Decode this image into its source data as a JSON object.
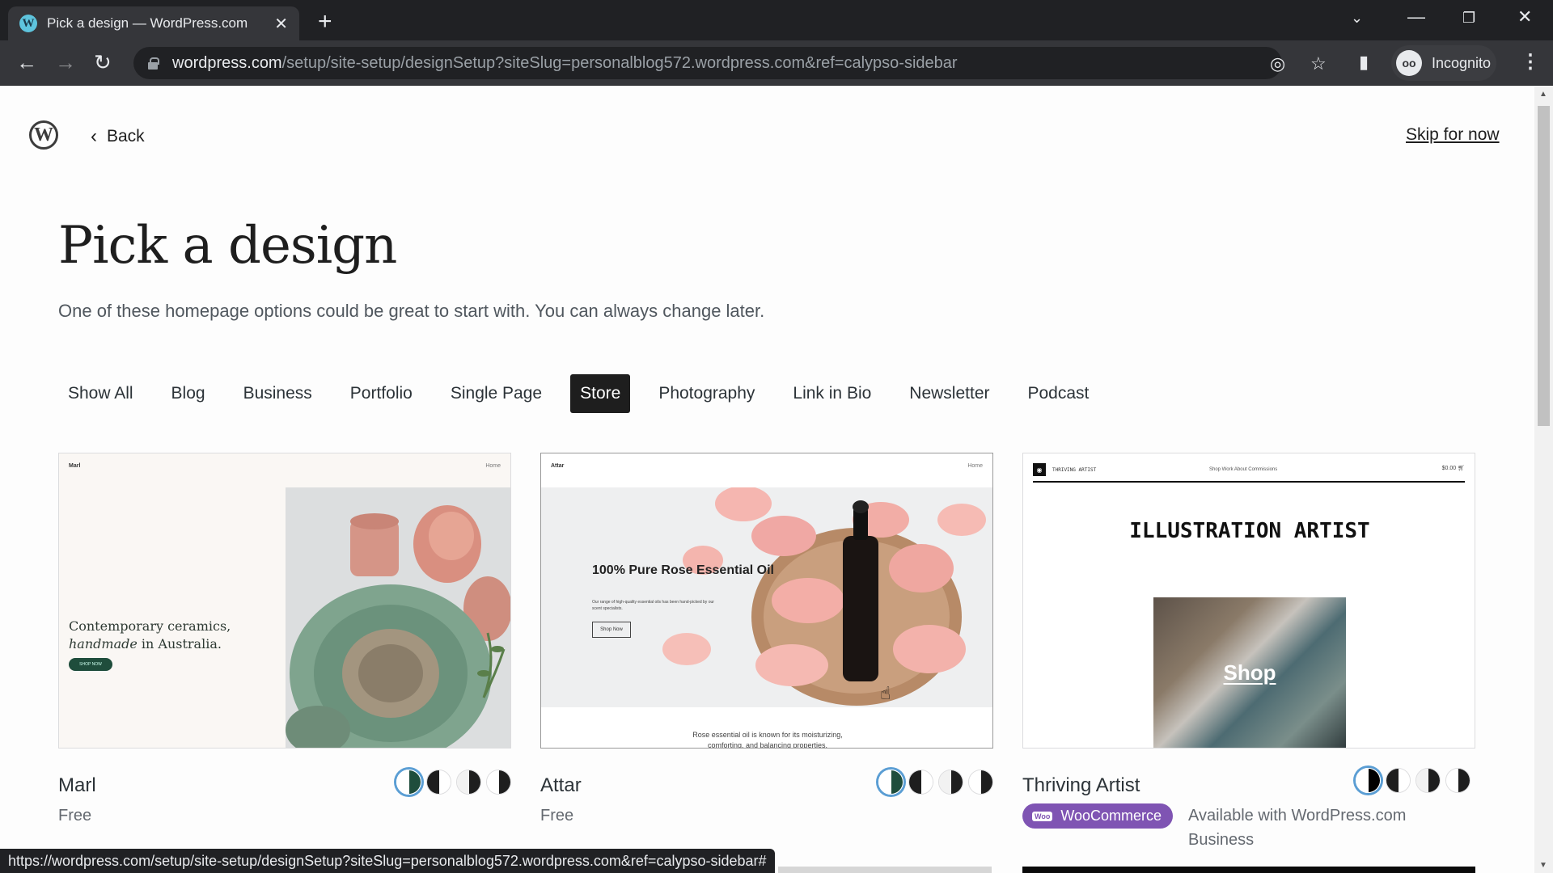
{
  "browser": {
    "tab_title": "Pick a design — WordPress.com",
    "favicon": "wordpress-icon",
    "url_host": "wordpress.com",
    "url_path": "/setup/site-setup/designSetup?siteSlug=personalblog572.wordpress.com&ref=calypso-sidebar",
    "profile_label": "Incognito",
    "status_url": "https://wordpress.com/setup/site-setup/designSetup?siteSlug=personalblog572.wordpress.com&ref=calypso-sidebar#"
  },
  "header": {
    "back_label": "Back",
    "skip_label": "Skip for now"
  },
  "main": {
    "title": "Pick a design",
    "subtitle": "One of these homepage options could be great to start with. You can always change later.",
    "filters": [
      {
        "label": "Show All",
        "active": false
      },
      {
        "label": "Blog",
        "active": false
      },
      {
        "label": "Business",
        "active": false
      },
      {
        "label": "Portfolio",
        "active": false
      },
      {
        "label": "Single Page",
        "active": false
      },
      {
        "label": "Store",
        "active": true
      },
      {
        "label": "Photography",
        "active": false
      },
      {
        "label": "Link in Bio",
        "active": false
      },
      {
        "label": "Newsletter",
        "active": false
      },
      {
        "label": "Podcast",
        "active": false
      }
    ],
    "designs": [
      {
        "name": "Marl",
        "price": "Free",
        "preview": {
          "brand": "Marl",
          "nav": "Home",
          "headline_1": "Contemporary ceramics,",
          "headline_2_italic": "handmade",
          "headline_2_rest": " in Australia.",
          "button": "SHOP NOW"
        },
        "swatches": [
          {
            "left": "#ffffff",
            "right": "#1f4d3c",
            "selected": true
          },
          {
            "left": "#1e1e1e",
            "right": "#ffffff",
            "selected": false
          },
          {
            "left": "#f2f2f2",
            "right": "#1e1e1e",
            "selected": false
          },
          {
            "left": "#ffffff",
            "right": "#1e1e1e",
            "selected": false
          }
        ]
      },
      {
        "name": "Attar",
        "price": "Free",
        "preview": {
          "brand": "Attar",
          "nav": "Home",
          "headline": "100% Pure Rose Essential Oil",
          "description": "Our range of high-quality essential oils has been hand-picked by our scent specialists.",
          "button": "Shop Now",
          "footer_1": "Rose essential oil is known for its moisturizing,",
          "footer_2": "comforting, and balancing properties."
        },
        "swatches": [
          {
            "left": "#ffffff",
            "right": "#1f4d3c",
            "selected": true
          },
          {
            "left": "#1e1e1e",
            "right": "#ffffff",
            "selected": false
          },
          {
            "left": "#f2f2f2",
            "right": "#1e1e1e",
            "selected": false
          },
          {
            "left": "#ffffff",
            "right": "#1e1e1e",
            "selected": false
          }
        ]
      },
      {
        "name": "Thriving Artist",
        "badge": "WooCommerce",
        "availability": "Available with WordPress.com Business",
        "preview": {
          "brand": "THRIVING ARTIST",
          "nav": "Shop  Work  About  Commissions",
          "cart": "$0.00",
          "headline": "ILLUSTRATION ARTIST",
          "shop_label": "Shop"
        },
        "swatches": [
          {
            "left": "#ffffff",
            "right": "#000000",
            "selected": true
          },
          {
            "left": "#1e1e1e",
            "right": "#ffffff",
            "selected": false
          },
          {
            "left": "#f2f2f2",
            "right": "#1e1e1e",
            "selected": false
          },
          {
            "left": "#ffffff",
            "right": "#1e1e1e",
            "selected": false
          }
        ]
      }
    ]
  },
  "colors": {
    "active_filter_bg": "#1e1e1e",
    "woocommerce_purple": "#7f54b3",
    "selected_swatch_ring": "#5b9ed4"
  }
}
